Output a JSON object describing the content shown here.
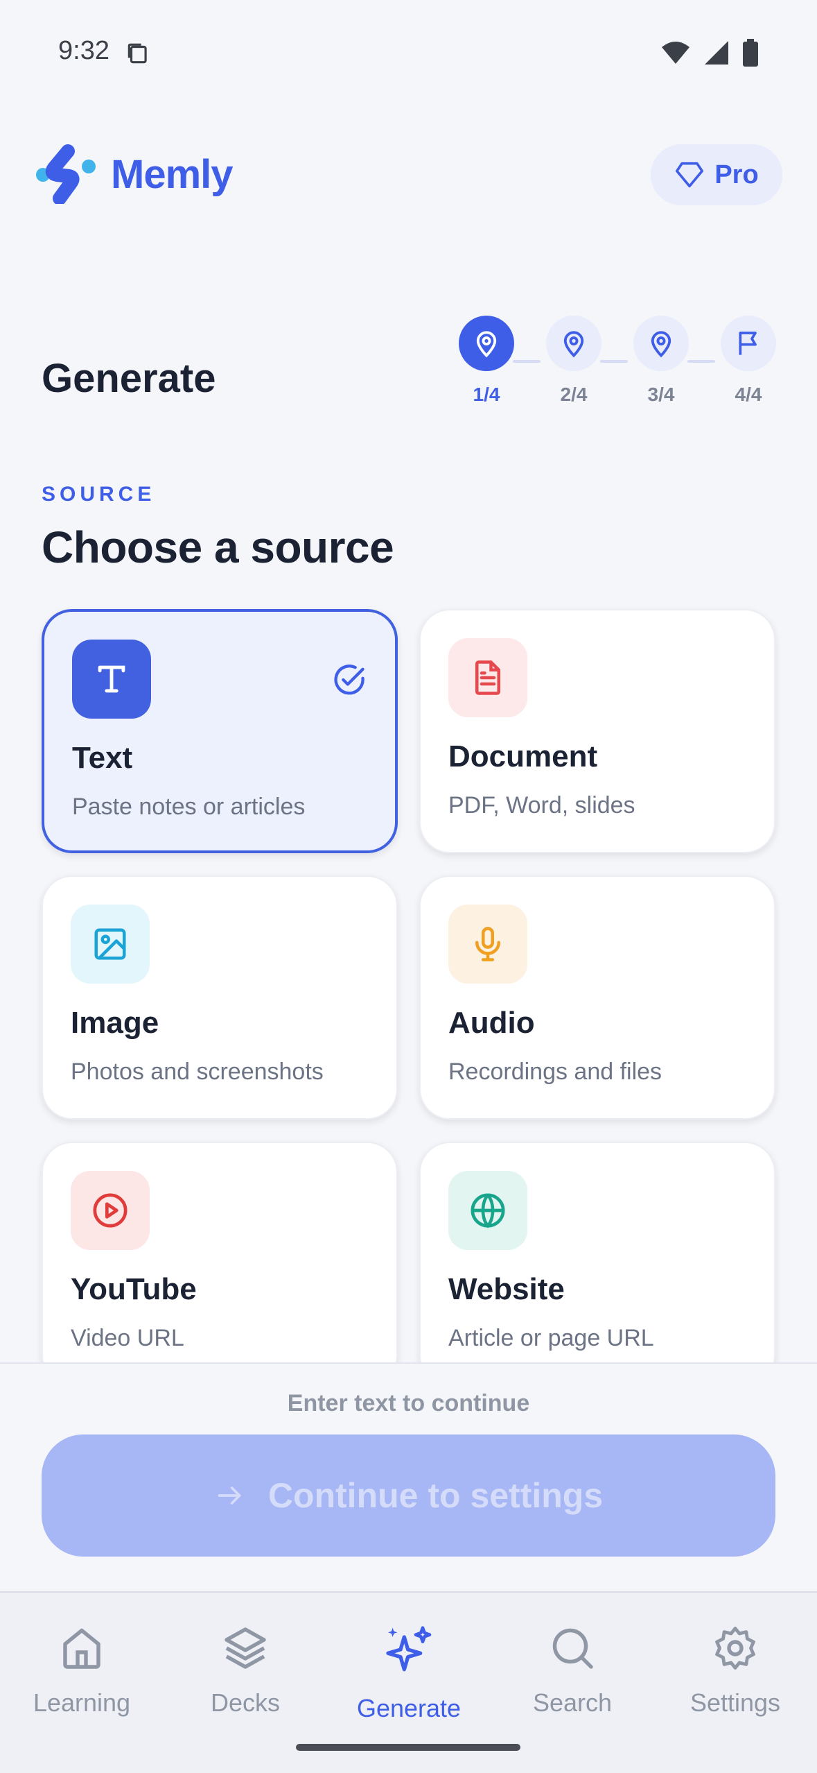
{
  "status_bar": {
    "time": "9:32"
  },
  "header": {
    "app_name": "Memly",
    "pro_label": "Pro"
  },
  "page": {
    "title": "Generate"
  },
  "stepper": {
    "current": 1,
    "steps": [
      {
        "label": "1/4",
        "icon": "map-pin-icon"
      },
      {
        "label": "2/4",
        "icon": "map-pin-icon"
      },
      {
        "label": "3/4",
        "icon": "map-pin-icon"
      },
      {
        "label": "4/4",
        "icon": "flag-icon"
      }
    ]
  },
  "section": {
    "eyebrow": "SOURCE",
    "heading": "Choose a source"
  },
  "sources": [
    {
      "title": "Text",
      "subtitle": "Paste notes or articles",
      "icon": "text-t-icon",
      "selected": true,
      "color": "#3f5ee8"
    },
    {
      "title": "Document",
      "subtitle": "PDF, Word, slides",
      "icon": "document-icon",
      "selected": false,
      "color": "#e5484d"
    },
    {
      "title": "Image",
      "subtitle": "Photos and screenshots",
      "icon": "image-icon",
      "selected": false,
      "color": "#1aa3d6"
    },
    {
      "title": "Audio",
      "subtitle": "Recordings and files",
      "icon": "microphone-icon",
      "selected": false,
      "color": "#f0a020"
    },
    {
      "title": "YouTube",
      "subtitle": "Video URL",
      "icon": "play-circle-icon",
      "selected": false,
      "color": "#e03c3c"
    },
    {
      "title": "Website",
      "subtitle": "Article or page URL",
      "icon": "globe-icon",
      "selected": false,
      "color": "#18a58c"
    }
  ],
  "footer": {
    "helper_text": "Enter text to continue",
    "continue_label": "Continue to settings"
  },
  "tabs": [
    {
      "label": "Learning",
      "icon": "home-icon",
      "active": false
    },
    {
      "label": "Decks",
      "icon": "layers-icon",
      "active": false
    },
    {
      "label": "Generate",
      "icon": "sparkles-icon",
      "active": true
    },
    {
      "label": "Search",
      "icon": "search-icon",
      "active": false
    },
    {
      "label": "Settings",
      "icon": "gear-icon",
      "active": false
    }
  ],
  "colors": {
    "accent": "#3f5ee8",
    "background": "#f5f6f9",
    "button_disabled": "#a7b6f4"
  }
}
